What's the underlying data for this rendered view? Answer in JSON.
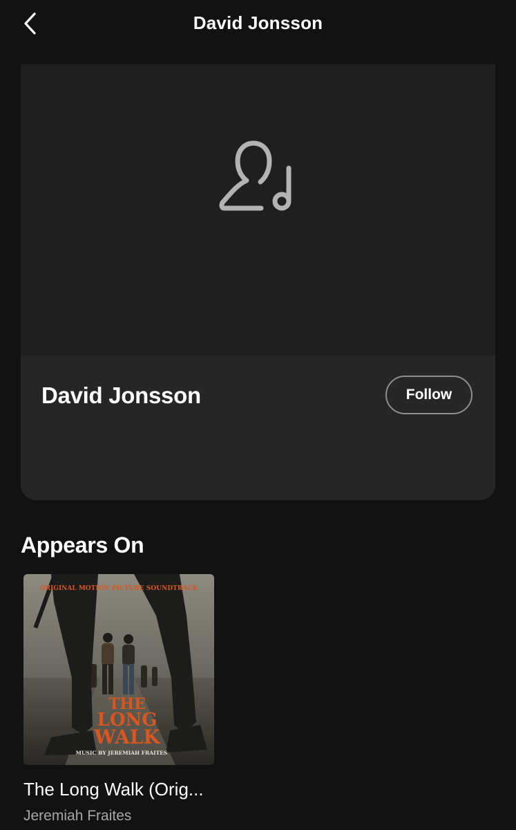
{
  "header": {
    "title": "David Jonsson"
  },
  "profile": {
    "name": "David Jonsson",
    "follow_label": "Follow"
  },
  "appears_on": {
    "section_title": "Appears On",
    "items": [
      {
        "title": "The Long Walk (Orig...",
        "subtitle": "Jeremiah Fraites",
        "cover_text": {
          "top": "ORIGINAL MOTION PICTURE SOUNDTRACK",
          "line1": "THE",
          "line2": "LONG",
          "line3": "WALK",
          "credit": "MUSIC BY JEREMIAH FRAITES"
        }
      }
    ]
  },
  "colors": {
    "background": "#121212",
    "card": "#262626",
    "image_area": "#1f1f1f",
    "secondary_text": "#a7a7a7",
    "cover_accent": "#d9571e"
  },
  "icons": {
    "back": "chevron-left-icon",
    "artist_placeholder": "artist-placeholder-icon"
  }
}
